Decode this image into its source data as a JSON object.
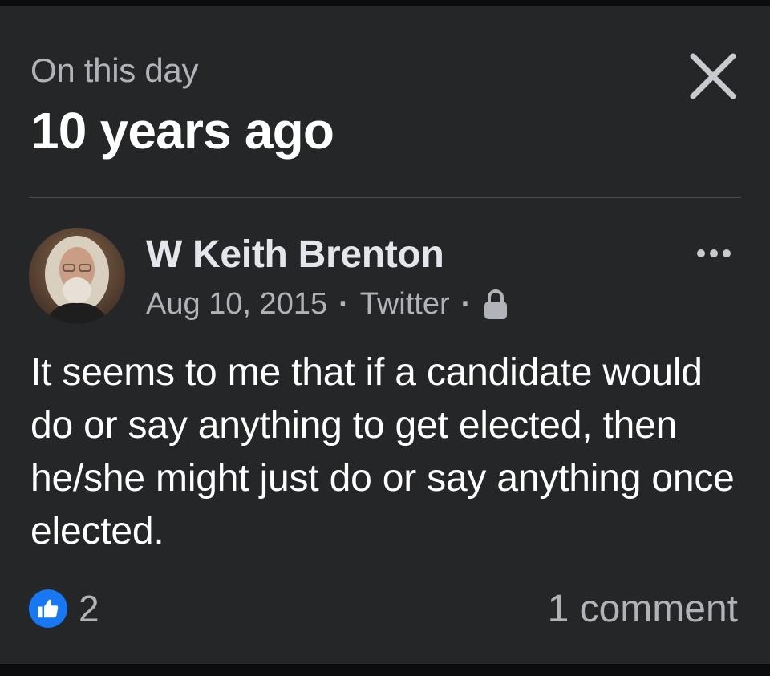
{
  "memory": {
    "eyebrow": "On this day",
    "headline": "10 years ago"
  },
  "post": {
    "author": "W Keith Brenton",
    "date": "Aug 10, 2015",
    "separator": "·",
    "source": "Twitter",
    "audience_icon": "lock-icon",
    "text": "It seems to me that if a candidate would do or say anything to get elected, then he/she might just do or say anything once elected.",
    "reactions": {
      "icon": "like-icon",
      "count": "2"
    },
    "comments": "1 comment"
  },
  "colors": {
    "card_bg": "#242627",
    "primary_text": "#ffffff",
    "secondary_text": "#b0b3b8",
    "like_blue": "#1877f2"
  },
  "icons": {
    "close": "close-icon",
    "more": "more-options-icon"
  }
}
